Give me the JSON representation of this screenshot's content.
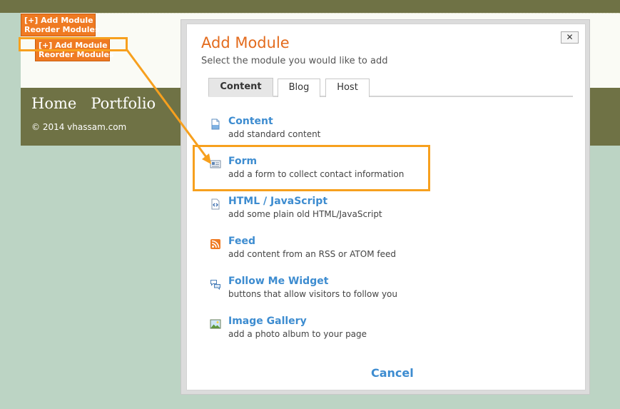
{
  "site": {
    "nav": [
      "Home",
      "Portfolio"
    ],
    "copyright": "© 2014 vhassam.com"
  },
  "module_buttons": {
    "add": "[+] Add Module",
    "reorder": "Reorder Modules"
  },
  "modal": {
    "title": "Add Module",
    "subtitle": "Select the module you would like to add",
    "close": "✕",
    "tabs": [
      {
        "label": "Content",
        "active": true
      },
      {
        "label": "Blog",
        "active": false
      },
      {
        "label": "Host",
        "active": false
      }
    ],
    "items": [
      {
        "name": "Content",
        "desc": "add standard content",
        "icon": "document-icon"
      },
      {
        "name": "Form",
        "desc": "add a form to collect contact information",
        "icon": "form-icon"
      },
      {
        "name": "HTML / JavaScript",
        "desc": "add some plain old HTML/JavaScript",
        "icon": "code-icon"
      },
      {
        "name": "Feed",
        "desc": "add content from an RSS or ATOM feed",
        "icon": "rss-icon"
      },
      {
        "name": "Follow Me Widget",
        "desc": "buttons that allow visitors to follow you",
        "icon": "speech-bubbles-icon"
      },
      {
        "name": "Image Gallery",
        "desc": "add a photo album to your page",
        "icon": "image-icon"
      }
    ],
    "cancel": "Cancel"
  },
  "colors": {
    "accent_orange": "#e36b1d",
    "highlight": "#f7a01e",
    "link_blue": "#3d8cd0",
    "header_olive": "#6f7245"
  }
}
